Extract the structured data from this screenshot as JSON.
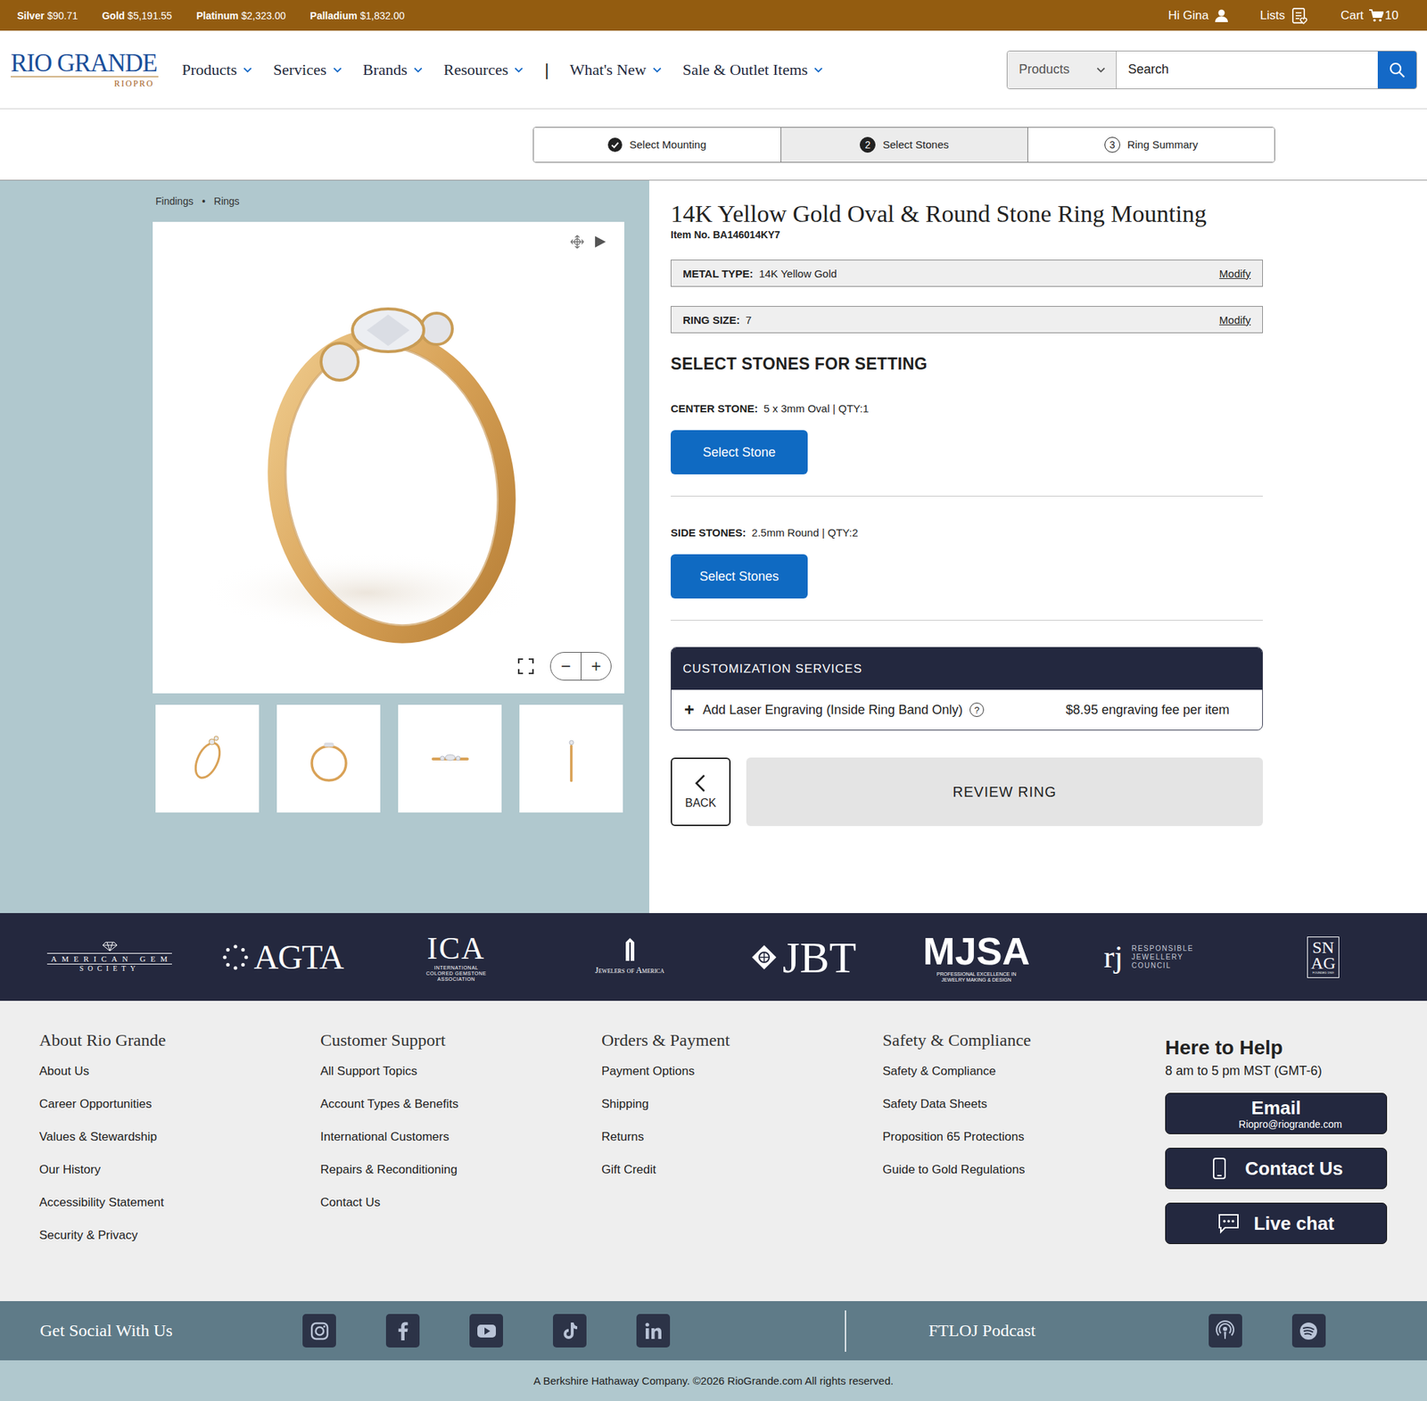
{
  "metal_prices": [
    {
      "label": "Silver",
      "value": "$90.71"
    },
    {
      "label": "Gold",
      "value": "$5,191.55"
    },
    {
      "label": "Platinum",
      "value": "$2,323.00"
    },
    {
      "label": "Palladium",
      "value": "$1,832.00"
    }
  ],
  "account": {
    "greeting": "Hi Gina",
    "lists": "Lists",
    "cart": "Cart",
    "cart_count": "10"
  },
  "logo": {
    "name": "RIO GRANDE",
    "sub": "RIOPRO"
  },
  "nav": [
    {
      "label": "Products",
      "kind": "menu"
    },
    {
      "label": "Services",
      "kind": "menu"
    },
    {
      "label": "Brands",
      "kind": "menu"
    },
    {
      "label": "Resources",
      "kind": "menu"
    },
    {
      "label": "|",
      "kind": "separator"
    },
    {
      "label": "What's New",
      "kind": "menu"
    },
    {
      "label": "Sale & Outlet Items",
      "kind": "menu"
    }
  ],
  "search": {
    "category": "Products",
    "placeholder": "Search"
  },
  "steps": [
    {
      "label": "Select Mounting",
      "completed": true,
      "selected": false
    },
    {
      "label": "Select Stones",
      "number": "2",
      "completed": false,
      "selected": true
    },
    {
      "label": "Ring Summary",
      "number": "3",
      "completed": false,
      "selected": false
    }
  ],
  "breadcrumb": {
    "items": [
      "Findings",
      "Rings"
    ],
    "separator": "•"
  },
  "viewer": {
    "zoom_out": "−",
    "zoom_in": "+"
  },
  "thumbnails": [
    {
      "kind": "angle"
    },
    {
      "kind": "front"
    },
    {
      "kind": "top"
    },
    {
      "kind": "side"
    }
  ],
  "product": {
    "title": "14K Yellow Gold Oval & Round Stone Ring Mounting",
    "item_label": "Item No.",
    "item_no": "BA146014KY7"
  },
  "options": [
    {
      "label": "METAL TYPE:",
      "value": "14K Yellow Gold",
      "action": "Modify"
    },
    {
      "label": "RING SIZE:",
      "value": "7",
      "action": "Modify"
    }
  ],
  "stones_heading": "SELECT STONES FOR SETTING",
  "stones": [
    {
      "label": "CENTER STONE:",
      "spec": "5 x 3mm Oval | QTY:1",
      "button": "Select Stone"
    },
    {
      "label": "SIDE STONES:",
      "spec": "2.5mm Round | QTY:2",
      "button": "Select Stones"
    }
  ],
  "customization": {
    "heading": "CUSTOMIZATION SERVICES",
    "items": [
      {
        "icon": "+",
        "label": "Add Laser Engraving (Inside Ring Band Only)",
        "help": "?",
        "price": "$8.95 engraving fee per item"
      }
    ]
  },
  "actions": {
    "back": "BACK",
    "review": "REVIEW RING"
  },
  "partners": [
    {
      "kind": "ags",
      "lines": [
        "AMERICAN GEM",
        "SOCIETY"
      ]
    },
    {
      "kind": "agta",
      "lines": [
        "AGTA"
      ]
    },
    {
      "kind": "ica",
      "lines": [
        "ICA",
        "INTERNATIONAL COLORED GEMSTONE ASSOCIATION"
      ]
    },
    {
      "kind": "joa",
      "lines": [
        "Jewelers of America"
      ]
    },
    {
      "kind": "jbt",
      "lines": [
        "JBT"
      ]
    },
    {
      "kind": "mjsa",
      "lines": [
        "MJSA",
        "PROFESSIONAL EXCELLENCE IN JEWELRY MAKING & DESIGN"
      ]
    },
    {
      "kind": "rjc",
      "lines": [
        "rj",
        "RESPONSIBLE JEWELLERY COUNCIL"
      ]
    },
    {
      "kind": "snag",
      "lines": [
        "SN",
        "AG",
        "FOUNDED 1969"
      ]
    }
  ],
  "footer": {
    "columns": [
      {
        "heading": "About Rio Grande",
        "links": [
          "About Us",
          "Career Opportunities",
          "Values & Stewardship",
          "Our History",
          "Accessibility Statement",
          "Security & Privacy"
        ]
      },
      {
        "heading": "Customer Support",
        "links": [
          "All Support Topics",
          "Account Types & Benefits",
          "International Customers",
          "Repairs & Reconditioning",
          "Contact Us"
        ]
      },
      {
        "heading": "Orders & Payment",
        "links": [
          "Payment Options",
          "Shipping",
          "Returns",
          "Gift Credit"
        ]
      },
      {
        "heading": "Safety & Compliance",
        "links": [
          "Safety & Compliance",
          "Safety Data Sheets",
          "Proposition 65 Protections",
          "Guide to Gold Regulations"
        ]
      }
    ],
    "help": {
      "heading": "Here to Help",
      "hours": "8 am to 5 pm MST (GMT-6)",
      "buttons": [
        {
          "kind": "email",
          "label": "Email",
          "sub": "Riopro@riogrande.com"
        },
        {
          "kind": "phone",
          "label": "Contact Us"
        },
        {
          "kind": "chat",
          "label": "Live chat"
        }
      ]
    }
  },
  "social": {
    "label": "Get Social With Us",
    "networks": [
      {
        "kind": "instagram"
      },
      {
        "kind": "facebook"
      },
      {
        "kind": "youtube"
      },
      {
        "kind": "tiktok"
      },
      {
        "kind": "linkedin"
      }
    ],
    "podcast_label": "FTLOJ Podcast",
    "podcast_links": [
      {
        "kind": "podcast"
      },
      {
        "kind": "spotify"
      }
    ]
  },
  "copyright": "A Berkshire Hathaway Company. ©2026 RioGrande.com All rights reserved."
}
